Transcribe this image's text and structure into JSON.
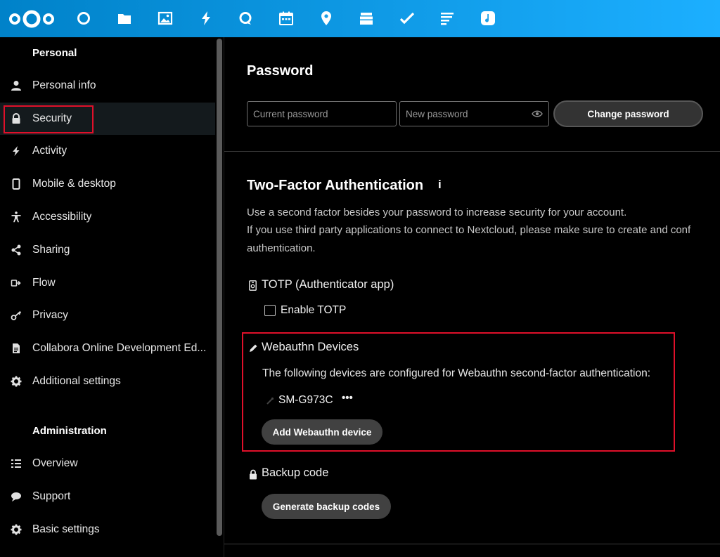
{
  "header": {
    "apps": [
      "dashboard-icon",
      "files-icon",
      "photos-icon",
      "activity-icon",
      "talk-icon",
      "calendar-icon",
      "maps-icon",
      "deck-icon",
      "tasks-icon",
      "notes-icon",
      "music-icon"
    ]
  },
  "sidebar": {
    "personal_heading": "Personal",
    "personal_items": [
      {
        "label": "Personal info",
        "icon": "person-icon"
      },
      {
        "label": "Security",
        "icon": "lock-icon"
      },
      {
        "label": "Activity",
        "icon": "lightning-icon"
      },
      {
        "label": "Mobile & desktop",
        "icon": "phone-icon"
      },
      {
        "label": "Accessibility",
        "icon": "accessibility-icon"
      },
      {
        "label": "Sharing",
        "icon": "share-icon"
      },
      {
        "label": "Flow",
        "icon": "flow-icon"
      },
      {
        "label": "Privacy",
        "icon": "key-icon"
      },
      {
        "label": "Collabora Online Development Ed...",
        "icon": "document-icon"
      },
      {
        "label": "Additional settings",
        "icon": "gear-icon"
      }
    ],
    "admin_heading": "Administration",
    "admin_items": [
      {
        "label": "Overview",
        "icon": "list-icon"
      },
      {
        "label": "Support",
        "icon": "speech-bubble-icon"
      },
      {
        "label": "Basic settings",
        "icon": "gear-icon"
      }
    ]
  },
  "password": {
    "title": "Password",
    "current_placeholder": "Current password",
    "new_placeholder": "New password",
    "change_button": "Change password"
  },
  "twofactor": {
    "title": "Two-Factor Authentication",
    "info_glyph": "i",
    "desc_line1": "Use a second factor besides your password to increase security for your account.",
    "desc_line2": "If you use third party applications to connect to Nextcloud, please make sure to create and conf",
    "desc_line3": "authentication.",
    "totp_title": "TOTP (Authenticator app)",
    "totp_checkbox_label": "Enable TOTP",
    "webauthn_title": "Webauthn Devices",
    "webauthn_desc": "The following devices are configured for Webauthn second-factor authentication:",
    "device_name": "SM-G973C",
    "device_menu": "•••",
    "add_device_button": "Add Webauthn device",
    "backup_title": "Backup code",
    "generate_button": "Generate backup codes"
  },
  "colors": {
    "header_gradient_start": "#0082c9",
    "header_gradient_end": "#1cafff",
    "highlight": "#e0102a"
  }
}
